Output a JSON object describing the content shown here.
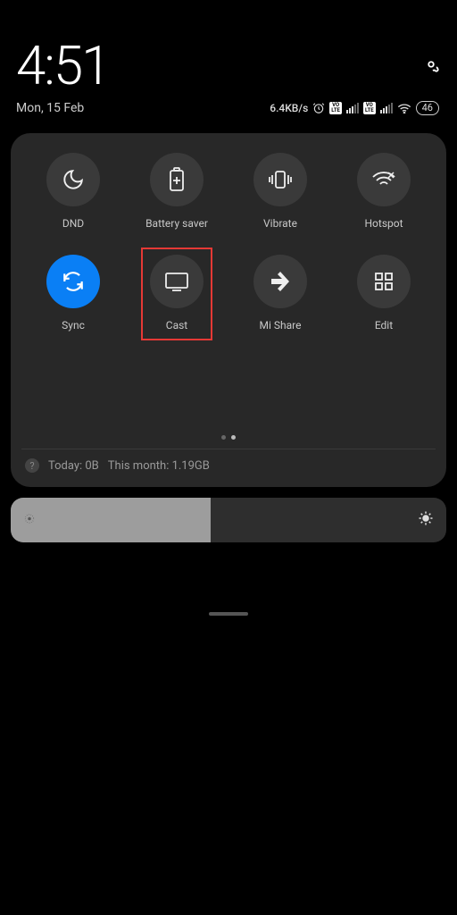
{
  "header": {
    "time": "4:51",
    "date": "Mon, 15 Feb",
    "data_speed": "6.4KB/s",
    "volte": "VO\nLTE",
    "battery": "46"
  },
  "tiles": [
    {
      "id": "dnd",
      "label": "DND",
      "active": false
    },
    {
      "id": "battery-saver",
      "label": "Battery saver",
      "active": false
    },
    {
      "id": "vibrate",
      "label": "Vibrate",
      "active": false
    },
    {
      "id": "hotspot",
      "label": "Hotspot",
      "active": false
    },
    {
      "id": "sync",
      "label": "Sync",
      "active": true
    },
    {
      "id": "cast",
      "label": "Cast",
      "active": false,
      "highlighted": true
    },
    {
      "id": "mi-share",
      "label": "Mi Share",
      "active": false
    },
    {
      "id": "edit",
      "label": "Edit",
      "active": false
    }
  ],
  "data_usage": {
    "today_label": "Today: 0B",
    "month_label": "This month: 1.19GB"
  },
  "brightness": {
    "percent": 46
  }
}
